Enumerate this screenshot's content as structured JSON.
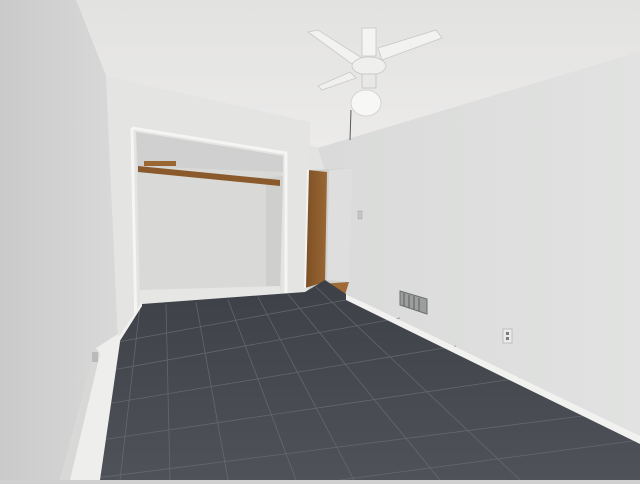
{
  "scene": {
    "subject": "empty bedroom",
    "elements": [
      "ceiling-fan",
      "open-closet",
      "doorway",
      "tile-floor",
      "baseboard-heater",
      "floor-vent",
      "wall-outlet",
      "light-switch"
    ],
    "colors": {
      "wall_left": "#d4d5d4",
      "wall_right": "#dddedd",
      "ceiling": "#e9e9e8",
      "floor": "#4a4d53",
      "door": "#8a5a2c",
      "trim": "#f2f2f0"
    }
  }
}
